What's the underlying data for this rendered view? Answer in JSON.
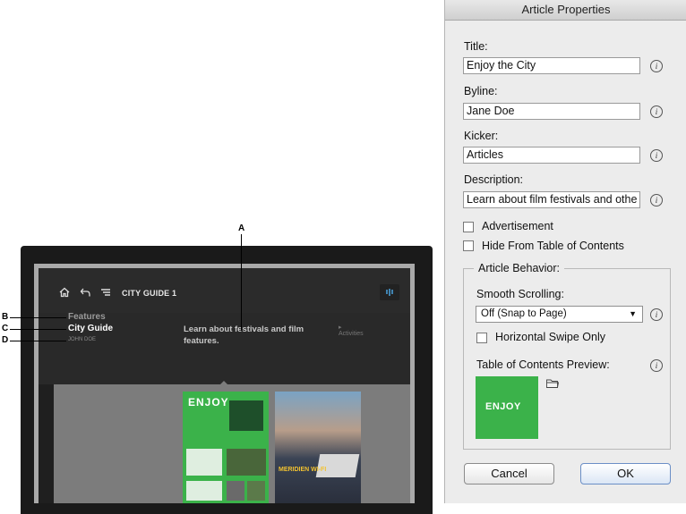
{
  "dialog": {
    "title": "Article Properties",
    "title_label": "Title:",
    "title_value": "Enjoy the City",
    "byline_label": "Byline:",
    "byline_value": "Jane Doe",
    "kicker_label": "Kicker:",
    "kicker_value": "Articles",
    "description_label": "Description:",
    "description_value": "Learn about film festivals and othe",
    "advertisement_label": "Advertisement",
    "hide_toc_label": "Hide From Table of Contents",
    "behavior_legend": "Article Behavior:",
    "smooth_scrolling_label": "Smooth Scrolling:",
    "smooth_scrolling_value": "Off (Snap to Page)",
    "horizontal_swipe_label": "Horizontal Swipe Only",
    "toc_preview_label": "Table of Contents Preview:",
    "toc_preview_text": "ENJOY",
    "cancel_label": "Cancel",
    "ok_label": "OK",
    "info_glyph": "i",
    "select_arrow": "▼"
  },
  "device": {
    "crumb": "CITY GUIDE 1",
    "kicker": "Features",
    "title": "City Guide",
    "byline": "JOHN DOE",
    "description": "Learn about festivals and film features.",
    "next": "Activities",
    "next_arrow": "▸",
    "thumb1_title": "ENJOY",
    "thumb2_title": "MERIDIEN WI-FI"
  },
  "callouts": {
    "a": "A",
    "b": "B",
    "c": "C",
    "d": "D"
  },
  "icons": [
    "home-icon",
    "back-icon",
    "toc-icon",
    "signal-icon",
    "info-icon",
    "folder-icon"
  ]
}
